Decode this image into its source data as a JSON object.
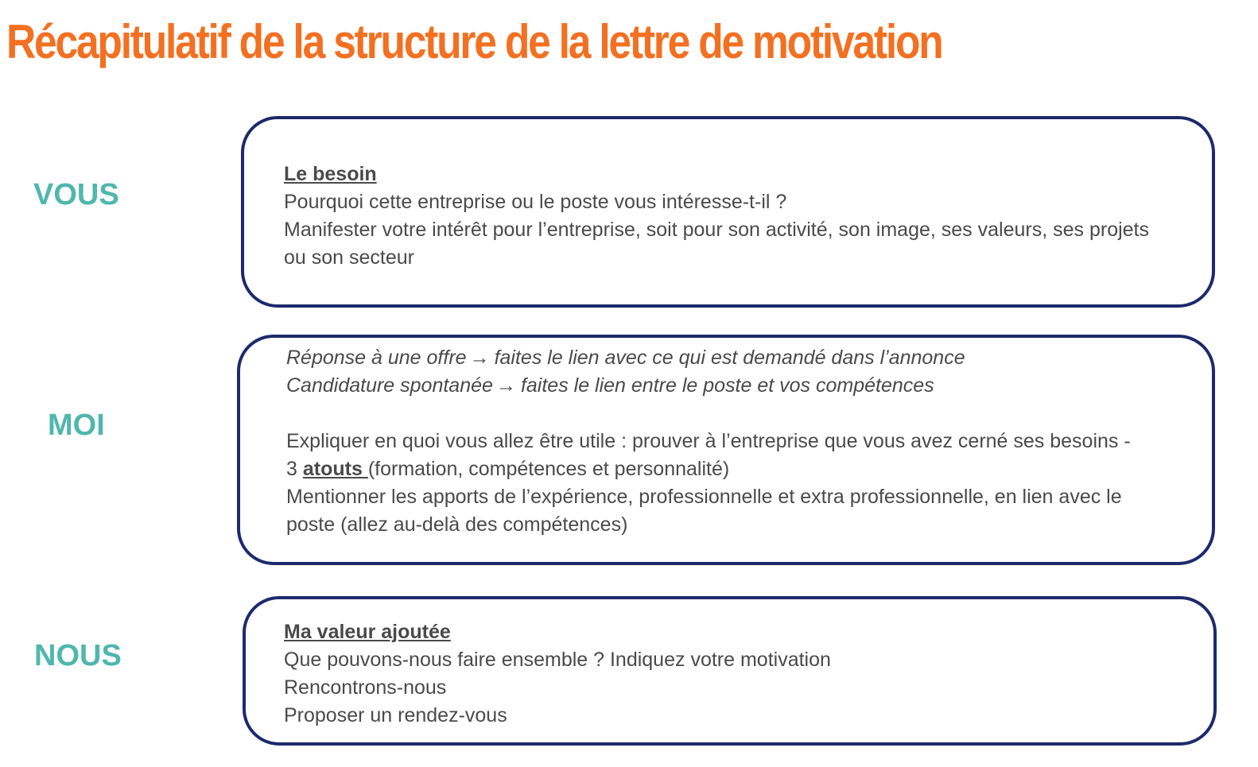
{
  "title": "Récapitulatif de la structure de la lettre de motivation",
  "colors": {
    "title": "#f37021",
    "side_label": "#4fb7ad",
    "box_border": "#1d2a6b",
    "body_text": "#4a4a4a"
  },
  "sections": {
    "vous": {
      "label": "VOUS",
      "heading": "Le besoin",
      "lines": [
        "Pourquoi cette entreprise ou le poste vous intéresse-t-il ?",
        "Manifester votre intérêt pour l’entreprise, soit pour son activité, son image, ses valeurs, ses projets ou son secteur"
      ]
    },
    "moi": {
      "label": "MOI",
      "offer_label": "Réponse à une offre",
      "offer_text": "faites le lien avec ce qui est demandé dans l’annonce",
      "spontaneous_label": "Candidature spontanée",
      "spontaneous_text": "faites le lien entre le poste et vos compétences",
      "arrow": "→",
      "explain": "Expliquer en quoi vous allez être utile : prouver à l’entreprise que vous avez cerné ses besoins -",
      "atouts_prefix": "3 ",
      "atouts": "atouts ",
      "atouts_suffix": "(formation, compétences et personnalité)",
      "mention": "Mentionner les apports de l’expérience, professionnelle et extra professionnelle, en lien avec le poste (allez au-delà des compétences)"
    },
    "nous": {
      "label": "NOUS",
      "heading": "Ma valeur ajoutée",
      "lines": [
        "Que pouvons-nous faire ensemble ? Indiquez votre motivation",
        "Rencontrons-nous",
        "Proposer un rendez-vous"
      ]
    }
  }
}
